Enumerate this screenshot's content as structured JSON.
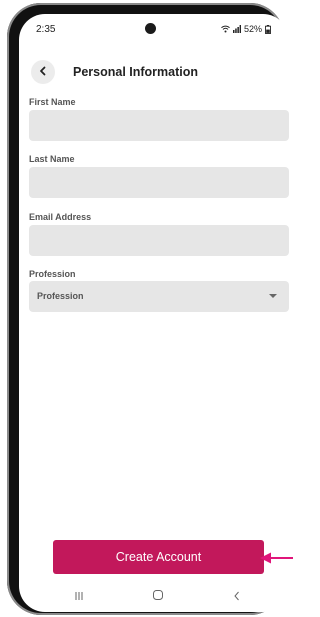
{
  "status_bar": {
    "time": "2:35",
    "battery": "52%"
  },
  "header": {
    "title": "Personal Information"
  },
  "form": {
    "first_name": {
      "label": "First Name",
      "value": "",
      "placeholder": ""
    },
    "last_name": {
      "label": "Last Name",
      "value": "",
      "placeholder": ""
    },
    "email": {
      "label": "Email Address",
      "value": "",
      "placeholder": ""
    },
    "profession": {
      "label": "Profession",
      "selected": "Profession"
    }
  },
  "actions": {
    "create_account_label": "Create Account"
  },
  "colors": {
    "accent": "#c2185b",
    "input_background": "#e6e6e6",
    "annotation_arrow": "#e0157a"
  },
  "icons": {
    "back": "chevron-left-icon",
    "wifi": "wifi-icon",
    "signal": "signal-icon",
    "battery": "battery-icon",
    "nav_recents": "recents-icon",
    "nav_home": "home-icon",
    "nav_back": "back-icon",
    "dropdown": "caret-down-icon"
  }
}
